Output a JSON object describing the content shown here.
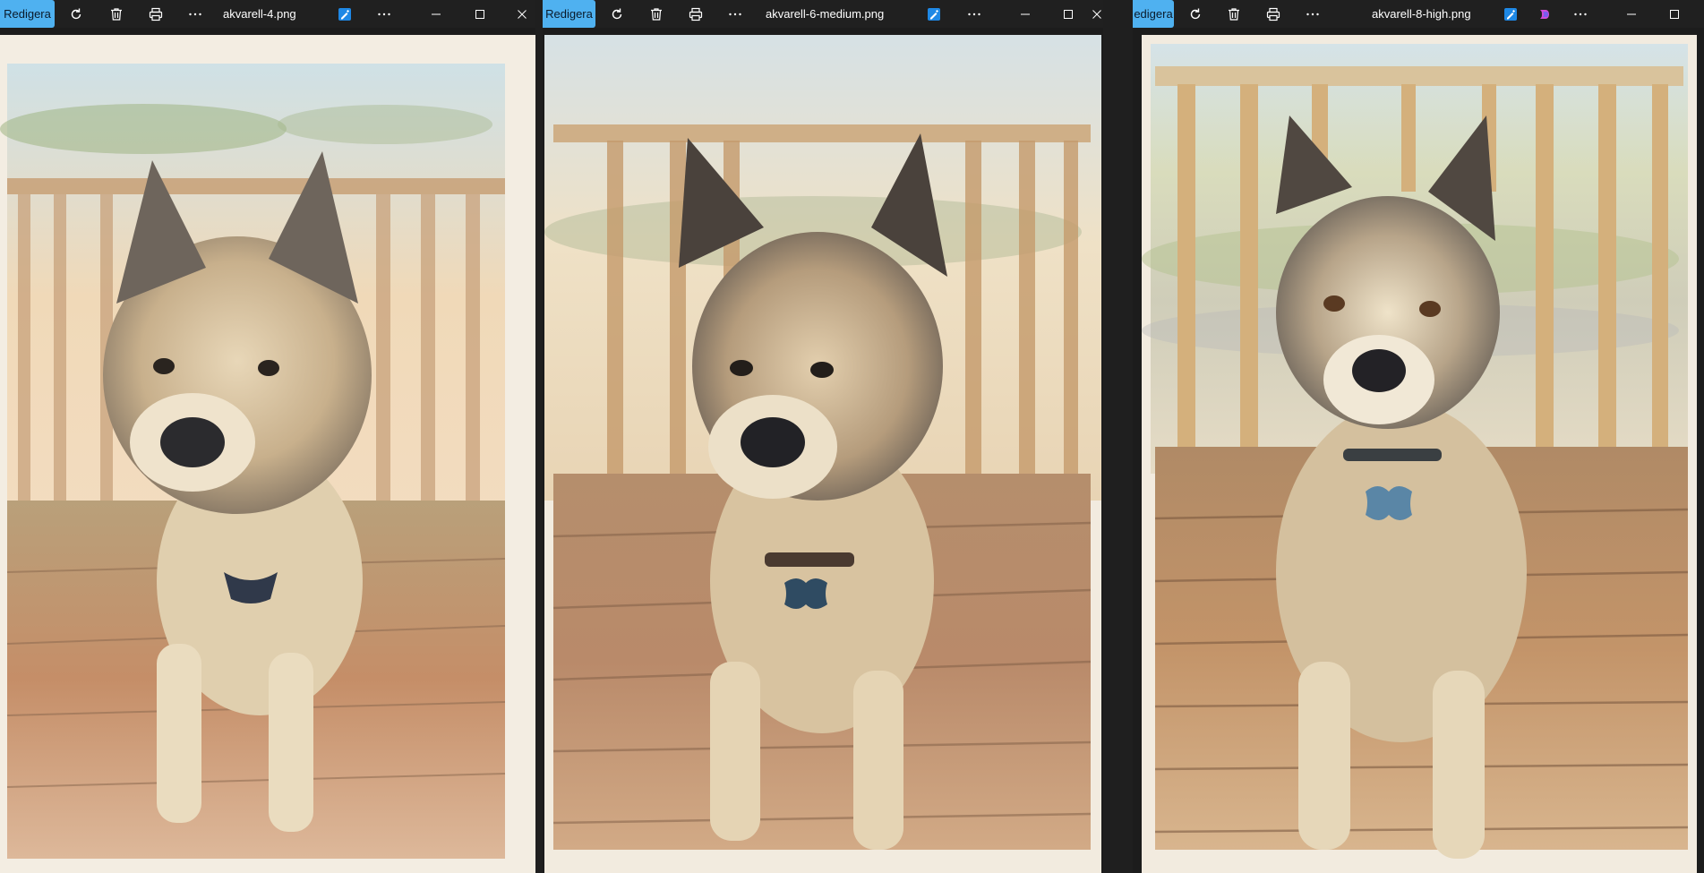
{
  "windows": [
    {
      "edit_label": "Redigera",
      "filename": "akvarell-4.png",
      "icons": [
        "rotate-icon",
        "delete-icon",
        "print-icon",
        "more-icon",
        "editor-icon",
        "more-icon",
        "minimize-icon",
        "maximize-icon",
        "close-icon"
      ]
    },
    {
      "edit_label": "Redigera",
      "filename": "akvarell-6-medium.png",
      "icons": [
        "rotate-icon",
        "delete-icon",
        "print-icon",
        "more-icon",
        "editor-icon",
        "more-icon",
        "minimize-icon",
        "maximize-icon",
        "close-icon"
      ]
    },
    {
      "edit_label": "edigera",
      "filename": "akvarell-8-high.png",
      "icons": [
        "rotate-icon",
        "delete-icon",
        "print-icon",
        "more-icon",
        "editor-icon",
        "copilot-icon",
        "more-icon",
        "minimize-icon",
        "maximize-icon"
      ]
    }
  ],
  "colors": {
    "titlebar": "#202020",
    "edit_accent": "#4fb1f0",
    "paper": "#f2ece1"
  }
}
